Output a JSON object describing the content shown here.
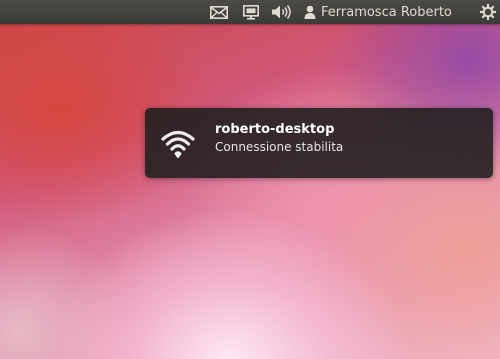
{
  "panel": {
    "indicators": {
      "mail_icon": "envelope-icon",
      "display_icon": "display-icon",
      "sound_icon": "speaker-icon",
      "user_icon": "person-icon",
      "session_icon": "gear-icon"
    },
    "user_name": "Ferramosca Roberto",
    "text_color": "#dfdbd2",
    "background_color": "#3c3b37"
  },
  "notification": {
    "icon": "wifi-icon",
    "title": "roberto-desktop",
    "body": "Connessione stabilita",
    "background_color": "#1e1e1e"
  }
}
